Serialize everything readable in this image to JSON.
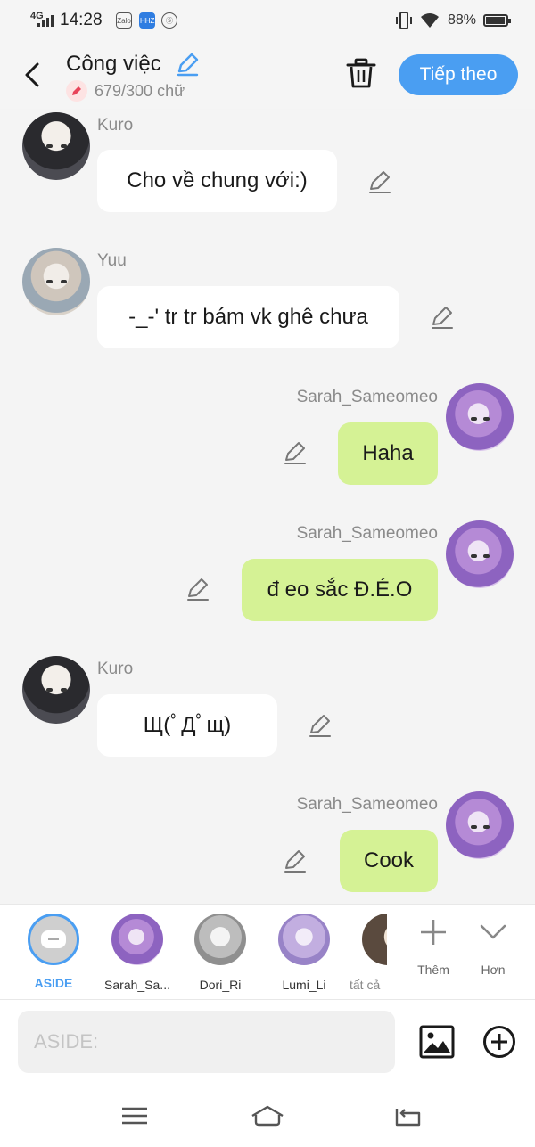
{
  "status_bar": {
    "network": "4G",
    "time": "14:28",
    "battery": "88%",
    "app_icons": [
      "Zalo",
      "HHZ",
      "Ⓢ"
    ]
  },
  "header": {
    "title": "Công việc",
    "word_count": "679/300 chữ",
    "next_button": "Tiếp theo"
  },
  "messages": [
    {
      "sender": "Kuro",
      "text": "Cho về chung với:)",
      "side": "left"
    },
    {
      "sender": "Yuu",
      "text": "-_-' tr tr bám vk ghê chưa",
      "side": "left"
    },
    {
      "sender": "Sarah_Sameomeo",
      "text": "Haha",
      "side": "right"
    },
    {
      "sender": "Sarah_Sameomeo",
      "text": "đ eo sắc Đ.É.O",
      "side": "right"
    },
    {
      "sender": "Kuro",
      "text": "Щ(ﾟДﾟщ)",
      "side": "left"
    },
    {
      "sender": "Sarah_Sameomeo",
      "text": "Cook",
      "side": "right"
    }
  ],
  "character_bar": {
    "aside_label": "ASIDE",
    "characters": [
      "Sarah_Sa...",
      "Dori_Ri",
      "Lumi_Li",
      "tất cả"
    ],
    "add_label": "Thêm",
    "more_label": "Hơn"
  },
  "input": {
    "placeholder": "ASIDE:"
  },
  "colors": {
    "accent": "#4a9ef2",
    "right_bubble": "#d5f295",
    "left_bubble": "#ffffff",
    "chat_background": "#f4f4f4"
  }
}
